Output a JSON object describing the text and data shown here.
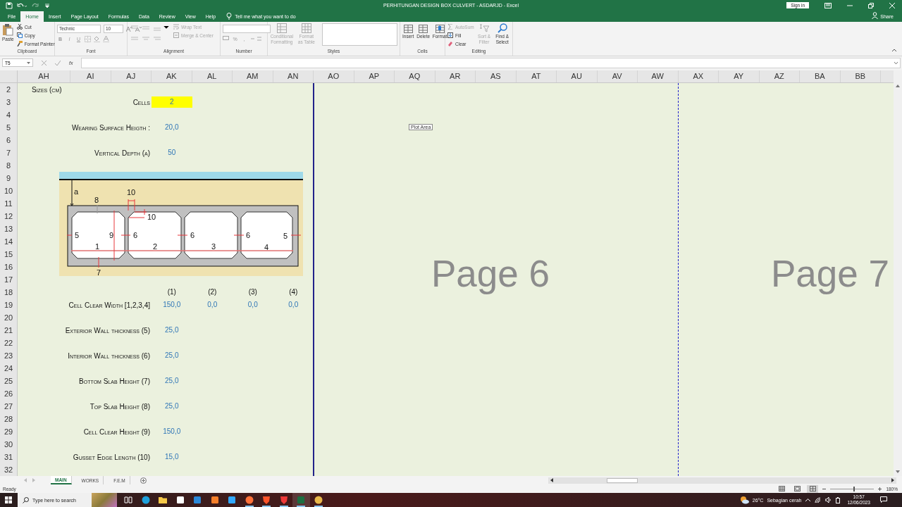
{
  "window": {
    "title": "PERHITUNGAN DESIGN BOX CULVERT - ASDARJD  -  Excel",
    "sign_in": "Sign in"
  },
  "ribbon_tabs": [
    {
      "label": "File",
      "selected": false
    },
    {
      "label": "Home",
      "selected": true
    },
    {
      "label": "Insert",
      "selected": false
    },
    {
      "label": "Page Layout",
      "selected": false
    },
    {
      "label": "Formulas",
      "selected": false
    },
    {
      "label": "Data",
      "selected": false
    },
    {
      "label": "Review",
      "selected": false
    },
    {
      "label": "View",
      "selected": false
    },
    {
      "label": "Help",
      "selected": false
    }
  ],
  "tell_me": "Tell me what you want to do",
  "share": "Share",
  "clipboard": {
    "label": "Clipboard",
    "paste": "Paste",
    "cut": "Cut",
    "copy": "Copy",
    "format_painter": "Format Painter"
  },
  "font": {
    "label": "Font",
    "name": "Technic",
    "size": "10",
    "bold": "B",
    "italic": "I",
    "underline": "U",
    "disabled": true
  },
  "alignment": {
    "label": "Alignment",
    "wrap_text": {
      "label": "Wrap Text",
      "disabled": true
    },
    "merge_center": {
      "label": "Merge & Center",
      "disabled": true
    }
  },
  "number": {
    "label": "Number",
    "percent": "%",
    "comma": ","
  },
  "styles": {
    "label": "Styles",
    "conditional_formatting": {
      "label": "Conditional Formatting",
      "disabled": true
    },
    "format_as_table": {
      "label": "Format as Table",
      "disabled": true
    }
  },
  "cells": {
    "label": "Cells",
    "buttons": [
      "Insert",
      "Delete",
      "Format"
    ]
  },
  "editing": {
    "label": "Editing",
    "autosum": {
      "label": "AutoSum",
      "disabled": true
    },
    "fill": {
      "label": "Fill",
      "disabled": false
    },
    "clear": {
      "label": "Clear",
      "disabled": false
    },
    "sort_filter": {
      "label": "Sort & Filter",
      "disabled": true
    },
    "find_select": {
      "label": "Find & Select",
      "disabled": false
    }
  },
  "formula_bar": {
    "name_box": "T5",
    "fx": "fx"
  },
  "columns": [
    "AH",
    "AI",
    "AJ",
    "AK",
    "AL",
    "AM",
    "AN",
    "AO",
    "AP",
    "AQ",
    "AR",
    "AS",
    "AT",
    "AU",
    "AV",
    "AW",
    "AX",
    "AY",
    "AZ",
    "BA",
    "BB"
  ],
  "rows": [
    {
      "number": "2",
      "kind": "heading",
      "label": "Sizes (cm)"
    },
    {
      "number": "3",
      "kind": "field",
      "label": "Cells",
      "values": [
        {
          "text": "2",
          "kind": "highlighted"
        }
      ]
    },
    {
      "number": "4"
    },
    {
      "number": "5",
      "kind": "field",
      "label": "Wearing Surface Heigth :",
      "values": [
        {
          "text": "20,0",
          "kind": "input"
        }
      ]
    },
    {
      "number": "6"
    },
    {
      "number": "7",
      "kind": "field",
      "label": "Vertical Depth (a)",
      "values": [
        {
          "text": "50",
          "kind": "input"
        }
      ]
    },
    {
      "number": "8"
    },
    {
      "number": "9"
    },
    {
      "number": "10"
    },
    {
      "number": "11"
    },
    {
      "number": "12"
    },
    {
      "number": "13"
    },
    {
      "number": "14"
    },
    {
      "number": "15"
    },
    {
      "number": "16"
    },
    {
      "number": "17"
    },
    {
      "number": "18",
      "kind": "field",
      "values": [
        {
          "text": "(1)",
          "kind": "header"
        },
        {
          "text": "(2)",
          "kind": "header"
        },
        {
          "text": "(3)",
          "kind": "header"
        },
        {
          "text": "(4)",
          "kind": "header"
        }
      ]
    },
    {
      "number": "19",
      "kind": "field",
      "label": "Cell Clear Width [1,2,3,4]",
      "values": [
        {
          "text": "150,0",
          "kind": "input"
        },
        {
          "text": "0,0",
          "kind": "input"
        },
        {
          "text": "0,0",
          "kind": "input"
        },
        {
          "text": "0,0",
          "kind": "input"
        }
      ]
    },
    {
      "number": "20"
    },
    {
      "number": "21",
      "kind": "field",
      "label": "Exterior Wall thickness (5)",
      "values": [
        {
          "text": "25,0",
          "kind": "input"
        }
      ]
    },
    {
      "number": "22"
    },
    {
      "number": "23",
      "kind": "field",
      "label": "Interior Wall thickness (6)",
      "values": [
        {
          "text": "25,0",
          "kind": "input"
        }
      ]
    },
    {
      "number": "24"
    },
    {
      "number": "25",
      "kind": "field",
      "label": "Bottom Slab Height (7)",
      "values": [
        {
          "text": "25,0",
          "kind": "input"
        }
      ]
    },
    {
      "number": "26"
    },
    {
      "number": "27",
      "kind": "field",
      "label": "Top Slab Height (8)",
      "values": [
        {
          "text": "25,0",
          "kind": "input"
        }
      ]
    },
    {
      "number": "28"
    },
    {
      "number": "29",
      "kind": "field",
      "label": "Cell Clear Height (9)",
      "values": [
        {
          "text": "150,0",
          "kind": "input"
        }
      ]
    },
    {
      "number": "30"
    },
    {
      "number": "31",
      "kind": "field",
      "label": "Gusset Edge Length (10)",
      "values": [
        {
          "text": "15,0",
          "kind": "input"
        }
      ]
    },
    {
      "number": "32"
    }
  ],
  "diagram": {
    "labels": [
      "a",
      "8",
      "10",
      "10",
      "5",
      "9",
      "6",
      "6",
      "6",
      "5",
      "1",
      "2",
      "3",
      "4",
      "7"
    ]
  },
  "page_labels": [
    "Page 6",
    "Page 7"
  ],
  "tooltip": "Plot Area",
  "sheet_tabs": [
    {
      "label": "MAIN",
      "selected": true
    },
    {
      "label": "WORKS",
      "selected": false
    },
    {
      "label": "F.E.M",
      "selected": false
    }
  ],
  "status": "Ready",
  "view_buttons": [
    {
      "kind": "normal",
      "selected": false
    },
    {
      "kind": "layout",
      "selected": false
    },
    {
      "kind": "pagebreak",
      "selected": true
    }
  ],
  "zoom": {
    "level": 0.53,
    "reading": "180%"
  },
  "taskbar": {
    "search_placeholder": "Type here to search",
    "apps": [
      {
        "kind": "taskview",
        "running": false,
        "selected": false
      },
      {
        "kind": "edge",
        "running": false,
        "selected": false
      },
      {
        "kind": "folder",
        "running": false,
        "selected": false
      },
      {
        "kind": "store",
        "running": false,
        "selected": false
      },
      {
        "kind": "mail",
        "running": false,
        "selected": false
      },
      {
        "kind": "editor",
        "running": false,
        "selected": false
      },
      {
        "kind": "photo",
        "running": false,
        "selected": false
      },
      {
        "kind": "firefox",
        "running": true,
        "selected": false
      },
      {
        "kind": "brave",
        "running": true,
        "selected": false
      },
      {
        "kind": "vivaldi",
        "running": true,
        "selected": false
      },
      {
        "kind": "sheet",
        "running": true,
        "selected": true
      },
      {
        "kind": "paint",
        "running": true,
        "selected": false
      }
    ],
    "temperature": "26°C",
    "weather": "Sebagian cerah",
    "time": "10:57",
    "date": "12/06/2023"
  }
}
